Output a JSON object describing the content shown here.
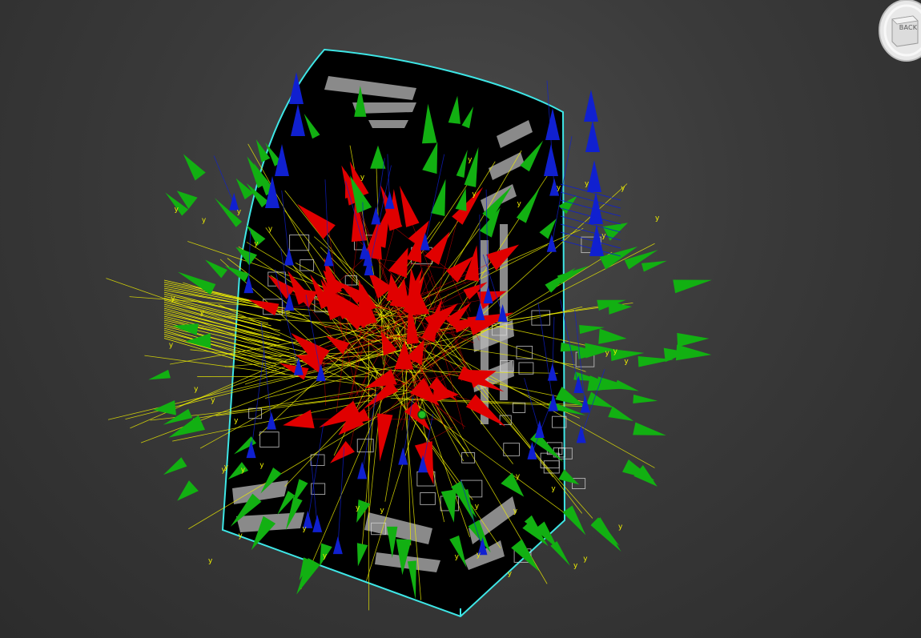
{
  "viewport": {
    "background_top": "#4a4a4a",
    "background_bottom": "#2c2c2c"
  },
  "viewcube": {
    "face_label": "BACK"
  },
  "colors": {
    "selection_outline": "#3ee6e6",
    "mesh_face": "#000000",
    "mesh_texture": "#b8b8b8",
    "helper_z": "#1020d0",
    "helper_x": "#e00000",
    "helper_normal": "#12b012",
    "guide_line": "#f0f000",
    "box_outline": "#d8d8d8"
  },
  "axis_labels": {
    "normal_axis": "y"
  },
  "icons": [
    "viewcube-icon",
    "selected-mesh-icon",
    "pivot-point-icon"
  ]
}
